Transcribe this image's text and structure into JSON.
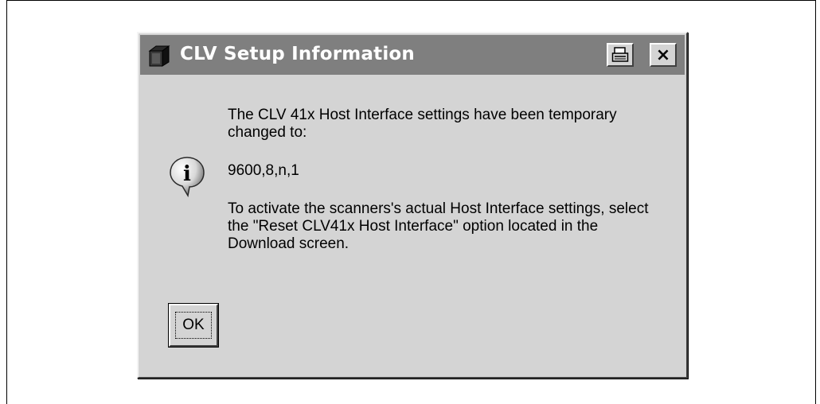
{
  "dialog": {
    "title": "CLV Setup Information",
    "icons": {
      "app": "app-icon",
      "print": "print-icon",
      "close": "close-icon",
      "info": "info-icon"
    },
    "close_glyph": "×",
    "message": {
      "line1": "The CLV 41x Host Interface settings have been temporary changed to:",
      "setting": "9600,8,n,1",
      "line2": "To activate the scanners's actual Host Interface settings, select the \"Reset CLV41x Host Interface\" option located in the Download screen."
    },
    "ok_label": "OK"
  },
  "colors": {
    "titlebar": "#7f7f7f",
    "dialog_bg": "#d4d4d4"
  }
}
